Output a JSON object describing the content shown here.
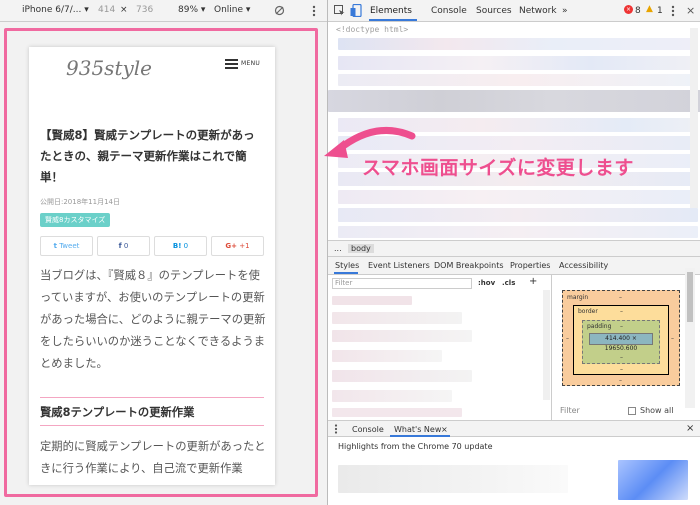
{
  "device_toolbar": {
    "device": "iPhone 6/7/... ▾",
    "width": "414",
    "times": "×",
    "height": "736",
    "zoom": "89% ▾",
    "network": "Online ▾"
  },
  "page": {
    "logo": "935style",
    "menu_label": "MENU",
    "title": "【賢威8】賢威テンプレートの更新があったときの、親テーマ更新作業はこれで簡単！",
    "date": "公開日:2018年11月14日",
    "tag": "賢威8カスタマイズ",
    "share": [
      {
        "label": "Tweet",
        "icon": "t",
        "color": "#55acee"
      },
      {
        "label": "0",
        "icon": "f",
        "color": "#3b5998"
      },
      {
        "label": "0",
        "icon": "B!",
        "color": "#008fde"
      },
      {
        "label": "+1",
        "icon": "G+",
        "color": "#dd4b39"
      }
    ],
    "intro": "当ブログは、『賢威８』のテンプレートを使っていますが、お使いのテンプレートの更新があった場合に、どのように親テーマの更新をしたらいいのか迷うことなくできるようまとめました。",
    "heading": "賢威8テンプレートの更新作業",
    "body": "定期的に賢威テンプレートの更新があったときに行う作業により、自己流で更新作業"
  },
  "caption": "スマホ画面サイズに変更します",
  "devtools": {
    "tabs": [
      "Elements",
      "Console",
      "Sources",
      "Network",
      "»"
    ],
    "errors": "8",
    "warnings": "1",
    "doctype": "<!doctype html>",
    "breadcrumb": [
      "...",
      "body"
    ],
    "style_tabs": [
      "Styles",
      "Event Listeners",
      "DOM Breakpoints",
      "Properties",
      "Accessibility"
    ],
    "filter_placeholder": "Filter",
    "hov": ":hov",
    "cls": ".cls",
    "plus": "+",
    "box_model": {
      "margin_label": "margin",
      "margin_value": "–",
      "border_label": "border",
      "border_value": "–",
      "padding_label": "padding",
      "padding_value": "–",
      "content_size": "414.400 × 19650.600",
      "side_value": "–"
    },
    "computed_filter": "Filter",
    "show_all": "Show all",
    "drawer_tabs": [
      "Console",
      "What's New",
      "×"
    ],
    "drawer_highlights": "Highlights from the Chrome 70 update"
  },
  "colors": {
    "accent_pink": "#ee4f8f",
    "frame_pink": "#f06aa0",
    "tag_teal": "#6bd0c9",
    "devtools_blue": "#3879d9"
  }
}
